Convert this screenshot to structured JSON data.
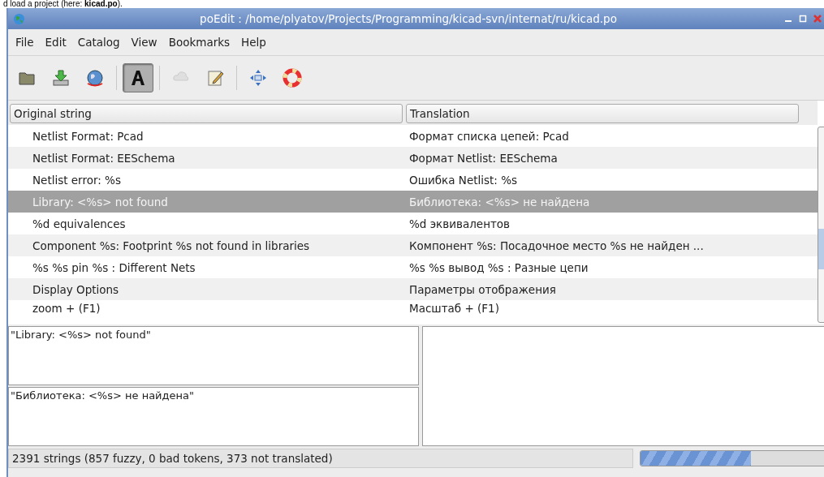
{
  "caption": "d load a project (here: **kicad.po**).",
  "window": {
    "title": "poEdit : /home/plyatov/Projects/Programming/kicad-svn/internat/ru/kicad.po"
  },
  "menu": [
    "File",
    "Edit",
    "Catalog",
    "View",
    "Bookmarks",
    "Help"
  ],
  "toolbar": [
    {
      "kind": "folder",
      "pressed": false,
      "disabled": false
    },
    {
      "kind": "download",
      "pressed": false,
      "disabled": false
    },
    {
      "kind": "globe",
      "pressed": false,
      "disabled": false
    },
    {
      "kind": "separator"
    },
    {
      "kind": "font",
      "pressed": true,
      "disabled": false
    },
    {
      "kind": "separator"
    },
    {
      "kind": "cloud",
      "pressed": false,
      "disabled": true
    },
    {
      "kind": "notepad",
      "pressed": false,
      "disabled": false
    },
    {
      "kind": "separator"
    },
    {
      "kind": "move",
      "pressed": false,
      "disabled": false
    },
    {
      "kind": "lifebuoy",
      "pressed": false,
      "disabled": false
    }
  ],
  "table": {
    "columns": [
      "Original string",
      "Translation"
    ],
    "rows": [
      {
        "original": "Netlist Format: Pcad",
        "translation": "Формат списка цепей: Pcad",
        "selected": false
      },
      {
        "original": "Netlist Format: EESchema",
        "translation": "Формат Netlist: EESchema",
        "selected": false
      },
      {
        "original": "Netlist error: %s",
        "translation": "Ошибка Netlist: %s",
        "selected": false
      },
      {
        "original": "Library: <%s> not found",
        "translation": "Библиотека: <%s> не найдена",
        "selected": true
      },
      {
        "original": "%d equivalences",
        "translation": "%d эквивалентов",
        "selected": false
      },
      {
        "original": "Component %s: Footprint %s not found in libraries",
        "translation": "Компонент %s: Посадочное место %s не найден ...",
        "selected": false
      },
      {
        "original": "%s %s pin %s : Different Nets",
        "translation": "%s %s вывод %s : Разные цепи",
        "selected": false
      },
      {
        "original": "Display Options",
        "translation": "Параметры отображения",
        "selected": false
      },
      {
        "original": "zoom + (F1)",
        "translation": "Масштаб + (F1)",
        "selected": false
      }
    ]
  },
  "source_text": "\"Library: <%s> not found\"",
  "translation_text": "\"Библиотека: <%s> не найдена\"",
  "status_bar": {
    "text": "2391 strings (857 fuzzy, 0 bad tokens, 373 not translated)",
    "level": 0.58
  }
}
